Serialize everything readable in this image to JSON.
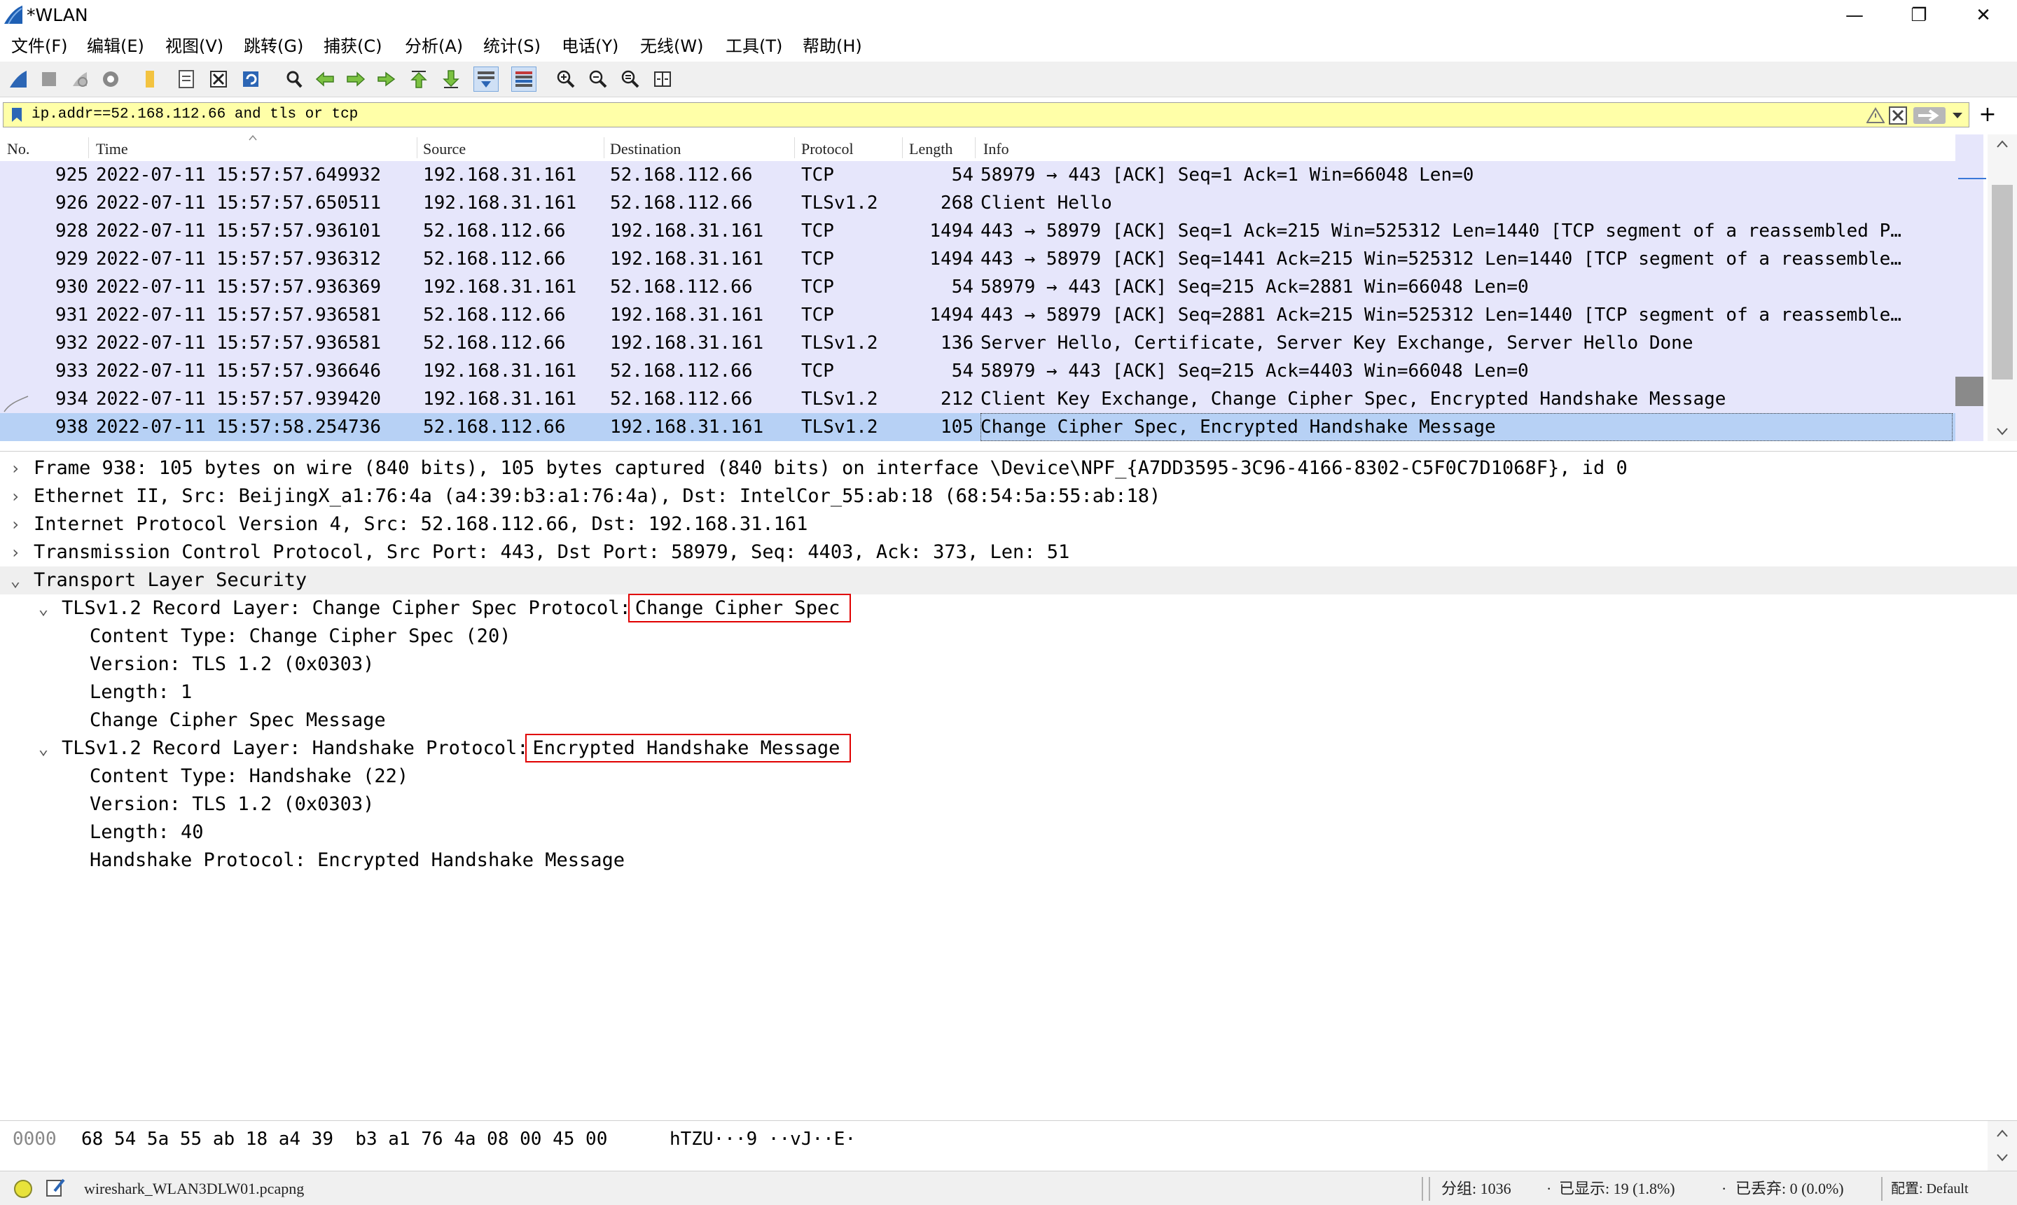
{
  "window": {
    "title": "*WLAN",
    "minimize": "—",
    "maximize": "❐",
    "close": "✕"
  },
  "menu": [
    "文件(F)",
    "编辑(E)",
    "视图(V)",
    "跳转(G)",
    "捕获(C)",
    "分析(A)",
    "统计(S)",
    "电话(Y)",
    "无线(W)",
    "工具(T)",
    "帮助(H)"
  ],
  "toolbar": {
    "icons": [
      "shark-fin-start-icon",
      "stop-capture-icon",
      "restart-capture-icon",
      "capture-options-icon",
      "open-file-icon",
      "save-file-icon",
      "close-file-icon",
      "reload-file-icon",
      "find-packet-icon",
      "go-back-icon",
      "go-forward-icon",
      "go-to-packet-icon",
      "go-first-icon",
      "go-last-icon",
      "auto-scroll-icon",
      "colorize-icon",
      "zoom-in-icon",
      "zoom-out-icon",
      "normal-size-icon",
      "resize-columns-icon"
    ]
  },
  "filter": {
    "value": "ip.addr==52.168.112.66 and tls or tcp",
    "add_button": "+"
  },
  "columns": [
    "No.",
    "Time",
    "Source",
    "Destination",
    "Protocol",
    "Length",
    "Info"
  ],
  "packets": [
    {
      "no": "925",
      "time": "2022-07-11 15:57:57.649932",
      "src": "192.168.31.161",
      "dst": "52.168.112.66",
      "proto": "TCP",
      "len": "54",
      "info": "58979 → 443 [ACK] Seq=1 Ack=1 Win=66048 Len=0"
    },
    {
      "no": "926",
      "time": "2022-07-11 15:57:57.650511",
      "src": "192.168.31.161",
      "dst": "52.168.112.66",
      "proto": "TLSv1.2",
      "len": "268",
      "info": "Client Hello"
    },
    {
      "no": "928",
      "time": "2022-07-11 15:57:57.936101",
      "src": "52.168.112.66",
      "dst": "192.168.31.161",
      "proto": "TCP",
      "len": "1494",
      "info": "443 → 58979 [ACK] Seq=1 Ack=215 Win=525312 Len=1440 [TCP segment of a reassembled P…"
    },
    {
      "no": "929",
      "time": "2022-07-11 15:57:57.936312",
      "src": "52.168.112.66",
      "dst": "192.168.31.161",
      "proto": "TCP",
      "len": "1494",
      "info": "443 → 58979 [ACK] Seq=1441 Ack=215 Win=525312 Len=1440 [TCP segment of a reassemble…"
    },
    {
      "no": "930",
      "time": "2022-07-11 15:57:57.936369",
      "src": "192.168.31.161",
      "dst": "52.168.112.66",
      "proto": "TCP",
      "len": "54",
      "info": "58979 → 443 [ACK] Seq=215 Ack=2881 Win=66048 Len=0"
    },
    {
      "no": "931",
      "time": "2022-07-11 15:57:57.936581",
      "src": "52.168.112.66",
      "dst": "192.168.31.161",
      "proto": "TCP",
      "len": "1494",
      "info": "443 → 58979 [ACK] Seq=2881 Ack=215 Win=525312 Len=1440 [TCP segment of a reassemble…"
    },
    {
      "no": "932",
      "time": "2022-07-11 15:57:57.936581",
      "src": "52.168.112.66",
      "dst": "192.168.31.161",
      "proto": "TLSv1.2",
      "len": "136",
      "info": "Server Hello, Certificate, Server Key Exchange, Server Hello Done"
    },
    {
      "no": "933",
      "time": "2022-07-11 15:57:57.936646",
      "src": "192.168.31.161",
      "dst": "52.168.112.66",
      "proto": "TCP",
      "len": "54",
      "info": "58979 → 443 [ACK] Seq=215 Ack=4403 Win=66048 Len=0"
    },
    {
      "no": "934",
      "time": "2022-07-11 15:57:57.939420",
      "src": "192.168.31.161",
      "dst": "52.168.112.66",
      "proto": "TLSv1.2",
      "len": "212",
      "info": "Client Key Exchange, Change Cipher Spec, Encrypted Handshake Message"
    },
    {
      "no": "938",
      "time": "2022-07-11 15:57:58.254736",
      "src": "52.168.112.66",
      "dst": "192.168.31.161",
      "proto": "TLSv1.2",
      "len": "105",
      "info": "Change Cipher Spec, Encrypted Handshake Message"
    }
  ],
  "selected_packet_index": 9,
  "details": {
    "frame": "Frame 938: 105 bytes on wire (840 bits), 105 bytes captured (840 bits) on interface \\Device\\NPF_{A7DD3595-3C96-4166-8302-C5F0C7D1068F}, id 0",
    "ethernet": "Ethernet II, Src: BeijingX_a1:76:4a (a4:39:b3:a1:76:4a), Dst: IntelCor_55:ab:18 (68:54:5a:55:ab:18)",
    "ip": "Internet Protocol Version 4, Src: 52.168.112.66, Dst: 192.168.31.161",
    "tcp": "Transmission Control Protocol, Src Port: 443, Dst Port: 58979, Seq: 4403, Ack: 373, Len: 51",
    "tls": "Transport Layer Security",
    "record1": {
      "prefix": "TLSv1.2 Record Layer: Change Cipher Spec Protocol:",
      "highlight": "Change Cipher Spec",
      "fields": [
        "Content Type: Change Cipher Spec (20)",
        "Version: TLS 1.2 (0x0303)",
        "Length: 1",
        "Change Cipher Spec Message"
      ]
    },
    "record2": {
      "prefix": "TLSv1.2 Record Layer: Handshake Protocol:",
      "highlight": "Encrypted Handshake Message",
      "fields": [
        "Content Type: Handshake (22)",
        "Version: TLS 1.2 (0x0303)",
        "Length: 40",
        "Handshake Protocol: Encrypted Handshake Message"
      ]
    }
  },
  "hex": {
    "offset": "0000",
    "bytes": "68 54 5a 55 ab 18 a4 39  b3 a1 76 4a 08 00 45 00",
    "ascii": "hTZU···9 ··vJ··E·"
  },
  "status": {
    "file": "wireshark_WLAN3DLW01.pcapng",
    "packets": "分组: 1036",
    "displayed": "已显示: 19 (1.8%)",
    "dropped": "已丢弃: 0 (0.0%)",
    "profile": "配置: Default"
  },
  "colors": {
    "row_bg": "#e6e6fb",
    "selected_bg": "#b7d1f5",
    "filter_bg": "#ffffa8",
    "highlight_box": "#e00000"
  }
}
